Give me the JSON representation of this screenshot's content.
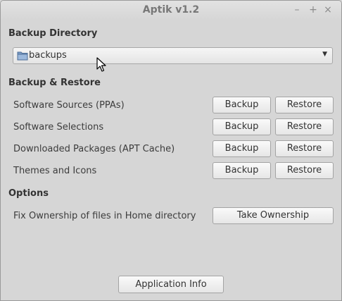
{
  "window": {
    "title": "Aptik v1.2",
    "controls": {
      "minimize": "–",
      "maximize": "+",
      "close": "×"
    }
  },
  "backup_directory": {
    "heading": "Backup Directory",
    "selected": "backups",
    "icon": "folder-icon"
  },
  "backup_restore": {
    "heading": "Backup & Restore",
    "rows": [
      {
        "label": "Software Sources (PPAs)",
        "backup": "Backup",
        "restore": "Restore"
      },
      {
        "label": "Software Selections",
        "backup": "Backup",
        "restore": "Restore"
      },
      {
        "label": "Downloaded Packages (APT Cache)",
        "backup": "Backup",
        "restore": "Restore"
      },
      {
        "label": "Themes and Icons",
        "backup": "Backup",
        "restore": "Restore"
      }
    ]
  },
  "options": {
    "heading": "Options",
    "rows": [
      {
        "label": "Fix Ownership of files in Home directory",
        "button": "Take Ownership"
      }
    ]
  },
  "footer": {
    "app_info_label": "Application Info"
  }
}
